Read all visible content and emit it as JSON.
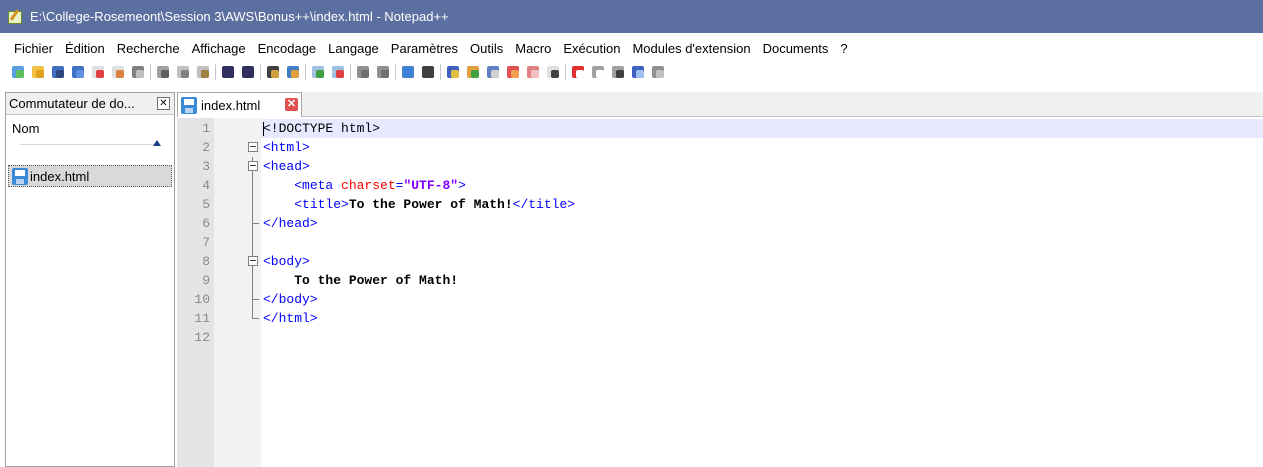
{
  "window": {
    "title": "E:\\College-Rosemeont\\Session 3\\AWS\\Bonus++\\index.html - Notepad++"
  },
  "menu": [
    "Fichier",
    "Édition",
    "Recherche",
    "Affichage",
    "Encodage",
    "Langage",
    "Paramètres",
    "Outils",
    "Macro",
    "Exécution",
    "Modules d'extension",
    "Documents",
    "?"
  ],
  "toolbar": {
    "icons": [
      "new-file-icon",
      "open-file-icon",
      "save-icon",
      "save-all-icon",
      "close-icon",
      "close-all-icon",
      "print-icon",
      "cut-icon",
      "copy-icon",
      "paste-icon",
      "undo-icon",
      "redo-icon",
      "find-icon",
      "replace-icon",
      "zoom-in-icon",
      "zoom-out-icon",
      "sync-vertical-icon",
      "sync-horizontal-icon",
      "word-wrap-icon",
      "show-all-chars-icon",
      "indent-guide-icon",
      "user-language-icon",
      "doc-map-icon",
      "function-list-icon",
      "folder-workspace-icon",
      "monitoring-icon",
      "record-macro-icon",
      "stop-macro-icon",
      "play-macro-icon",
      "run-macro-multiple-icon",
      "save-macro-icon"
    ]
  },
  "switcher": {
    "title": "Commutateur de do...",
    "close_label": "✕",
    "column": "Nom",
    "files": [
      "index.html"
    ]
  },
  "tabs": [
    {
      "label": "index.html",
      "close_label": "✕"
    }
  ],
  "editor": {
    "lines": [
      {
        "n": "1",
        "fold": "none",
        "tokens": [
          [
            "doctype",
            "<!DOCTYPE html>"
          ]
        ]
      },
      {
        "n": "2",
        "fold": "start",
        "tokens": [
          [
            "tag",
            "<html>"
          ]
        ]
      },
      {
        "n": "3",
        "fold": "start",
        "tokens": [
          [
            "tag",
            "<head>"
          ]
        ]
      },
      {
        "n": "4",
        "fold": "line",
        "tokens": [
          [
            "plain",
            "    "
          ],
          [
            "tag",
            "<meta "
          ],
          [
            "attr",
            "charset"
          ],
          [
            "tag",
            "="
          ],
          [
            "val",
            "\"UTF-8\""
          ],
          [
            "tag",
            ">"
          ]
        ]
      },
      {
        "n": "5",
        "fold": "line",
        "tokens": [
          [
            "plain",
            "    "
          ],
          [
            "tag",
            "<title>"
          ],
          [
            "text",
            "To the Power of Math!"
          ],
          [
            "tag",
            "</title>"
          ]
        ]
      },
      {
        "n": "6",
        "fold": "end",
        "tokens": [
          [
            "tag",
            "</head>"
          ]
        ]
      },
      {
        "n": "7",
        "fold": "line",
        "tokens": []
      },
      {
        "n": "8",
        "fold": "start",
        "tokens": [
          [
            "tag",
            "<body>"
          ]
        ]
      },
      {
        "n": "9",
        "fold": "line",
        "tokens": [
          [
            "plain",
            "    "
          ],
          [
            "text",
            "To the Power of Math!"
          ]
        ]
      },
      {
        "n": "10",
        "fold": "end",
        "tokens": [
          [
            "tag",
            "</body>"
          ]
        ]
      },
      {
        "n": "11",
        "fold": "end",
        "tokens": [
          [
            "tag",
            "</html>"
          ]
        ]
      },
      {
        "n": "12",
        "fold": "none",
        "tokens": []
      }
    ]
  },
  "colors": {
    "titlebar": "#5b6fa0",
    "tag": "#0000ff",
    "attribute": "#ff0000",
    "value": "#8000ff",
    "current_line": "#e8e8ff"
  }
}
